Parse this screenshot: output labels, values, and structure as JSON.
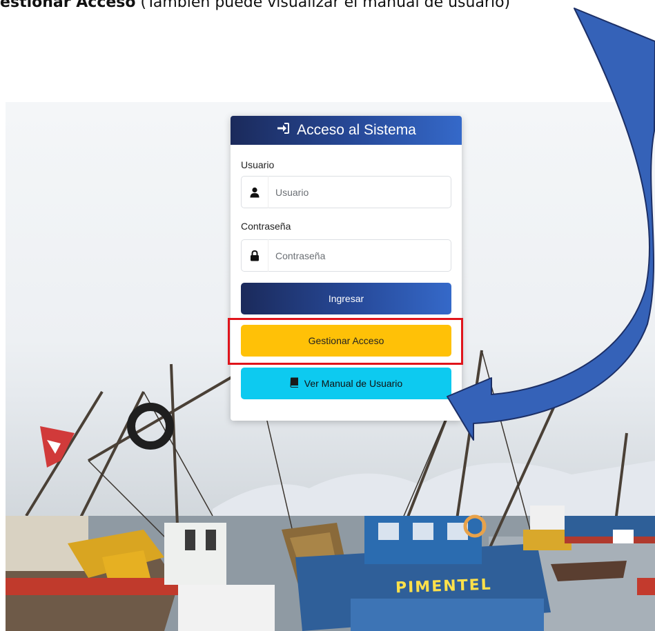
{
  "doc": {
    "caption_bold": "Gestionar Acceso",
    "caption_rest": " (También puede visualizar el manual de usuario)"
  },
  "login": {
    "title": "Acceso al Sistema",
    "title_icon": "sign-in-icon",
    "user_label": "Usuario",
    "user_placeholder": "Usuario",
    "user_icon": "user-icon",
    "password_label": "Contraseña",
    "password_placeholder": "Contraseña",
    "password_icon": "lock-icon",
    "submit_label": "Ingresar",
    "access_label": "Gestionar Acceso",
    "manual_label": "Ver Manual de Usuario",
    "manual_icon": "book-icon"
  },
  "background": {
    "boat_name": "PIMENTEL"
  },
  "colors": {
    "header_gradient_start": "#1b2a5b",
    "header_gradient_end": "#3569c9",
    "access_button": "#ffc107",
    "manual_button": "#0dcaf0",
    "highlight": "#e0141b",
    "arrow": "#3562b8"
  }
}
